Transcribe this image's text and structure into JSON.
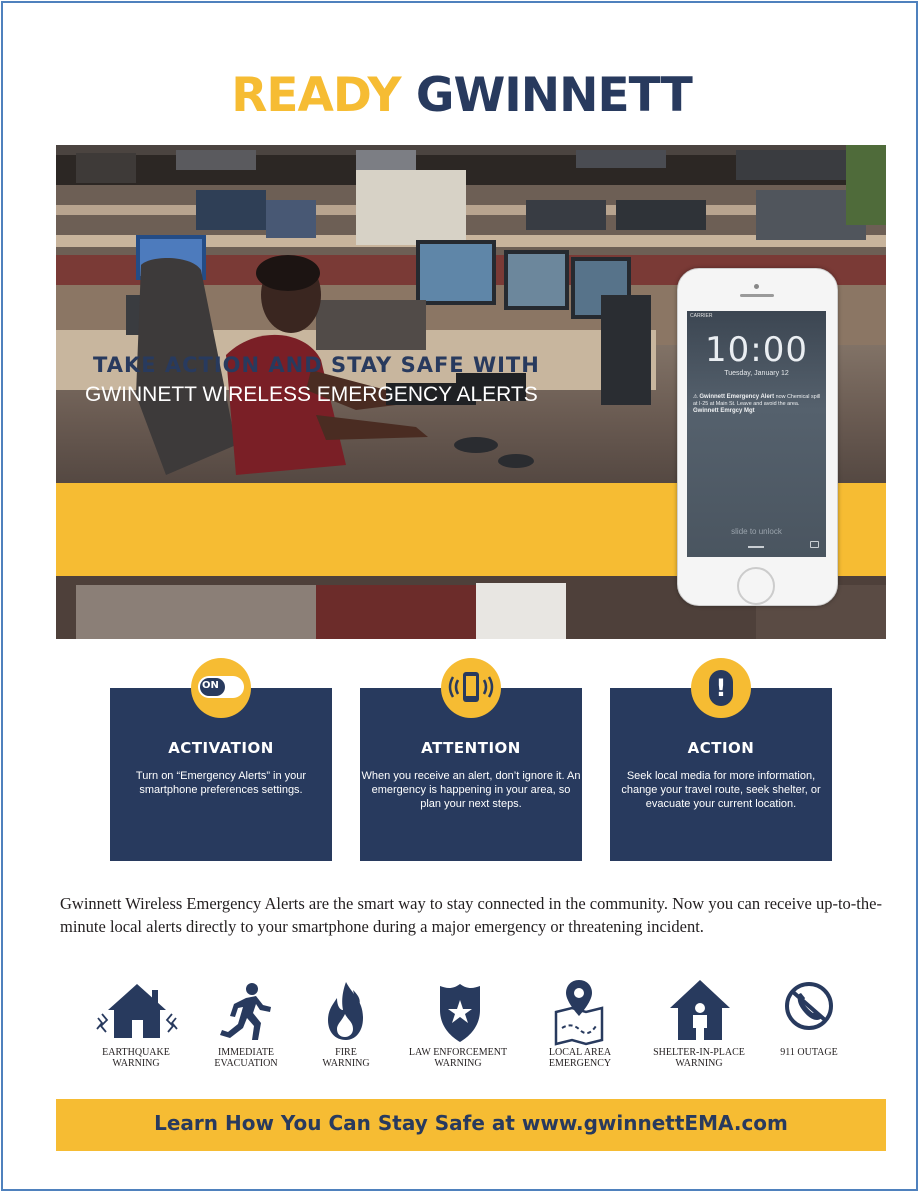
{
  "header": {
    "title_part1": "READY",
    "title_part2": "GWINNETT"
  },
  "hero": {
    "banner_line1": "TAKE ACTION AND STAY SAFE WITH",
    "banner_line2": "GWINNETT WIRELESS EMERGENCY ALERTS",
    "phone": {
      "carrier": "CARRIER",
      "time": "10:00",
      "date": "Tuesday, January 12",
      "alert_title": "Gwinnett Emergency Alert",
      "alert_when": "now",
      "alert_body": "Chemical spill at I-25 at Main St. Leave and avoid the area.",
      "alert_source": "Gwinnett Emrgcy Mgt",
      "unlock_text": "slide to unlock"
    }
  },
  "cards": [
    {
      "badge": "ON",
      "title": "ACTIVATION",
      "body": "Turn on “Emergency Alerts” in your smartphone preferences settings."
    },
    {
      "title": "ATTENTION",
      "body": "When you receive an alert, don’t ignore it. An emergency is happening in your area, so plan your next steps."
    },
    {
      "badge": "!",
      "title": "ACTION",
      "body": "Seek local media for more information, change your travel route, seek shelter, or evacuate your current location."
    }
  ],
  "intro": "Gwinnett Wireless Emergency Alerts are the smart way to stay connected in the community. Now you can receive up-to-the-minute local alerts directly to your smartphone during a major emergency or threatening incident.",
  "alert_types": [
    {
      "icon": "earthquake-house-icon",
      "label": "EARTHQUAKE\nWARNING"
    },
    {
      "icon": "running-person-icon",
      "label": "IMMEDIATE\nEVACUATION"
    },
    {
      "icon": "fire-icon",
      "label": "FIRE\nWARNING"
    },
    {
      "icon": "police-badge-icon",
      "label": "LAW ENFORCEMENT\nWARNING"
    },
    {
      "icon": "map-pin-icon",
      "label": "LOCAL AREA\nEMERGENCY"
    },
    {
      "icon": "house-person-icon",
      "label": "SHELTER-IN-PLACE\nWARNING"
    },
    {
      "icon": "no-phone-icon",
      "label": "911 OUTAGE"
    }
  ],
  "footer": {
    "text": "Learn How You Can Stay Safe at www.gwinnettEMA.com"
  },
  "colors": {
    "navy": "#283a5e",
    "gold": "#f6bc33",
    "frame": "#4f81bd"
  }
}
